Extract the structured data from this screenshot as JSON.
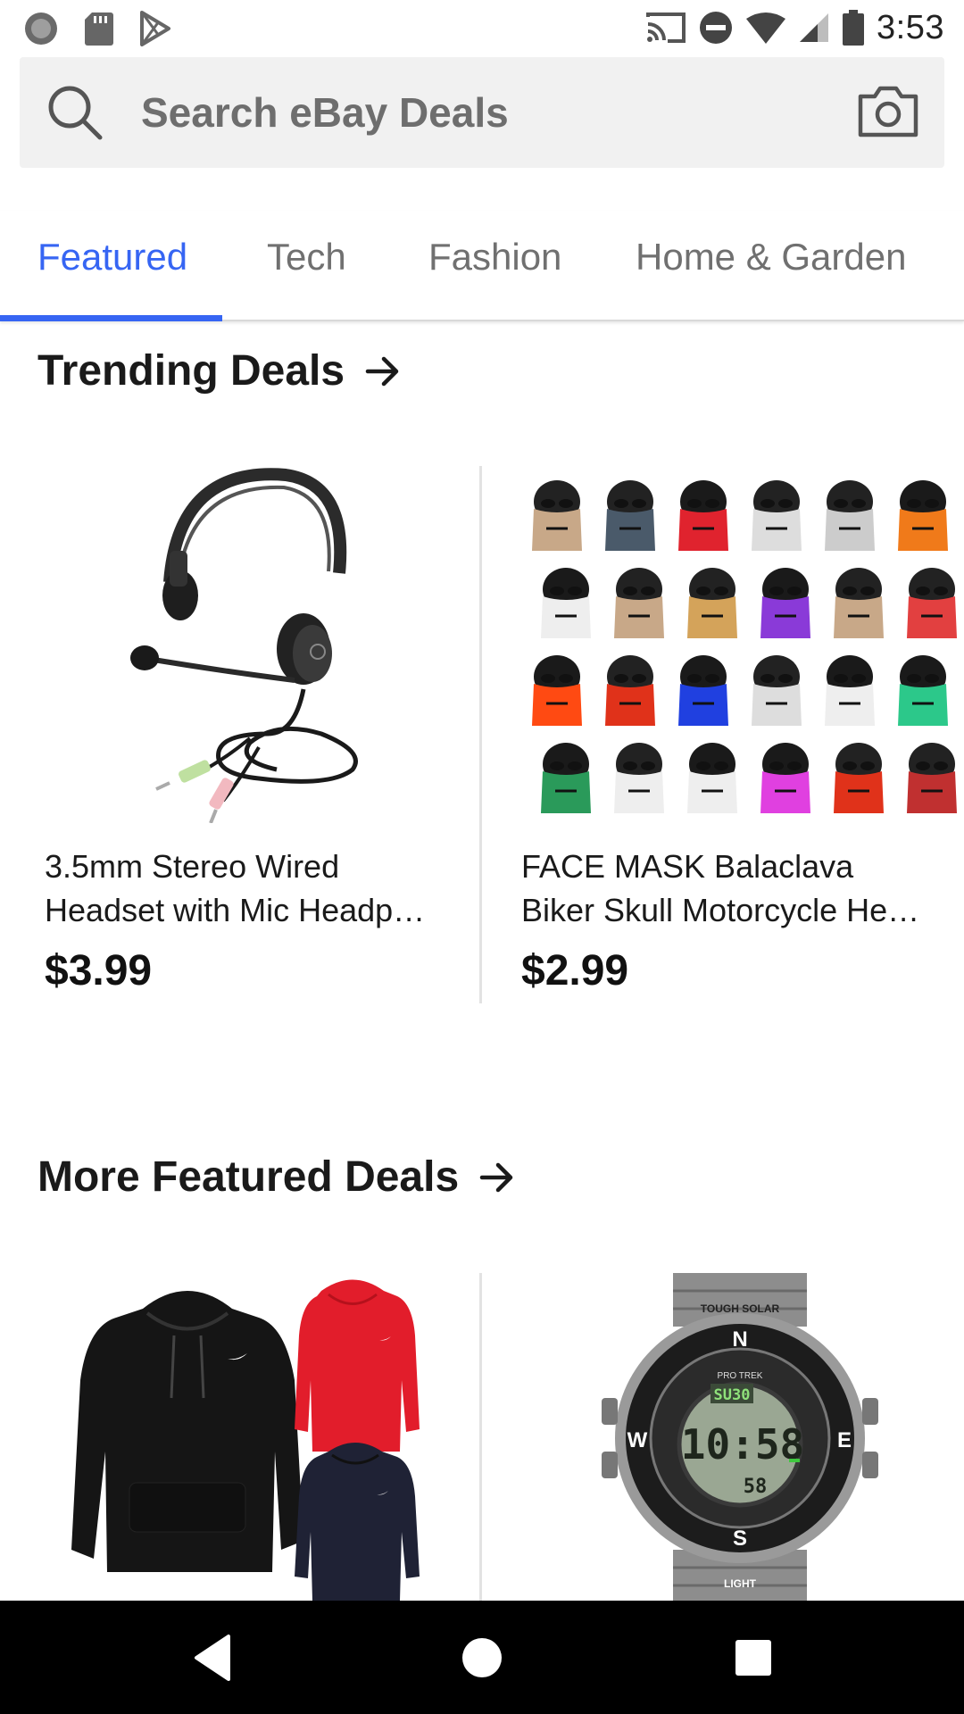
{
  "status_bar": {
    "time": "3:53",
    "left_icons": [
      "record-icon",
      "sd-card-icon",
      "play-store-icon"
    ],
    "right_icons": [
      "cast-icon",
      "do-not-disturb-icon",
      "wifi-icon",
      "signal-icon",
      "battery-icon"
    ]
  },
  "search": {
    "placeholder": "Search eBay Deals",
    "search_icon": "search-icon",
    "camera_icon": "camera-icon"
  },
  "tabs": [
    {
      "label": "Featured",
      "active": true
    },
    {
      "label": "Tech",
      "active": false
    },
    {
      "label": "Fashion",
      "active": false
    },
    {
      "label": "Home & Garden",
      "active": false
    }
  ],
  "accent_color": "#3665f3",
  "trending": {
    "title": "Trending Deals",
    "items": [
      {
        "title_line1": "3.5mm Stereo Wired",
        "title_line2": "Headset with Mic Headp…",
        "price": "$3.99",
        "image": "headset-image"
      },
      {
        "title_line1": "FACE MASK Balaclava",
        "title_line2": "Biker Skull Motorcycle He…",
        "price": "$2.99",
        "image": "face-masks-image"
      }
    ]
  },
  "more_featured": {
    "title": "More Featured Deals",
    "items": [
      {
        "image": "hoodies-image"
      },
      {
        "image": "watch-image",
        "watch_brand": "TOUGH SOLAR",
        "watch_time": "10:58",
        "watch_top": "SU30",
        "watch_bottom": "58",
        "watch_model": "PRO TREK",
        "watch_light": "LIGHT"
      }
    ]
  },
  "nav": {
    "back_icon": "back-icon",
    "home_icon": "home-icon",
    "recents_icon": "recents-icon"
  }
}
